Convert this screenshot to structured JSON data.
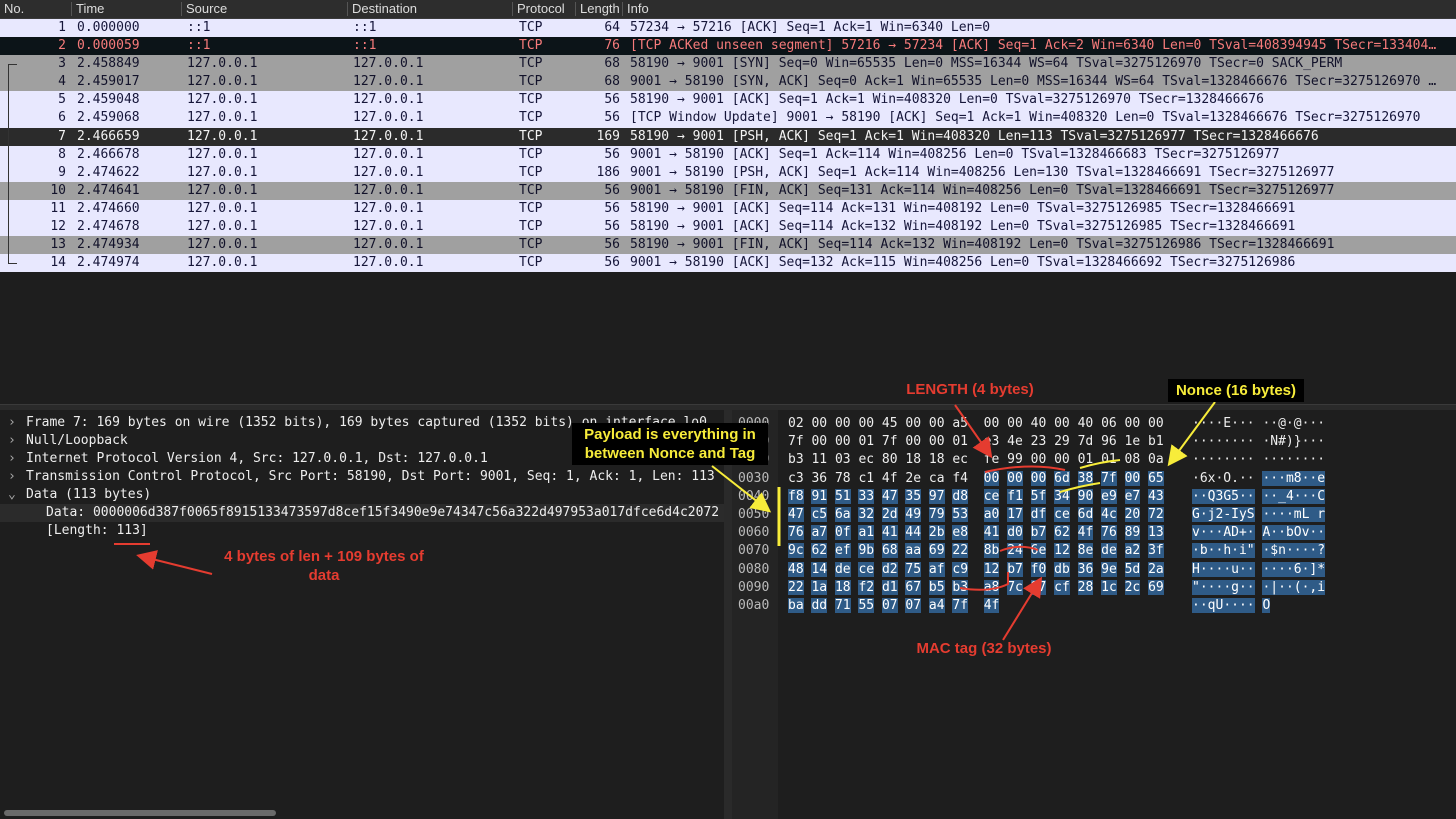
{
  "columns": [
    "No.",
    "Time",
    "Source",
    "Destination",
    "Protocol",
    "Length",
    "Info"
  ],
  "packets": [
    {
      "no": "1",
      "time": "0.000000",
      "src": "::1",
      "dst": "::1",
      "proto": "TCP",
      "len": "64",
      "info": "57234 → 57216 [ACK] Seq=1 Ack=1 Win=6340 Len=0"
    },
    {
      "no": "2",
      "time": "0.000059",
      "src": "::1",
      "dst": "::1",
      "proto": "TCP",
      "len": "76",
      "info": "[TCP ACKed unseen segment] 57216 → 57234 [ACK] Seq=1 Ack=2 Win=6340 Len=0 TSval=408394945 TSecr=133404…"
    },
    {
      "no": "3",
      "time": "2.458849",
      "src": "127.0.0.1",
      "dst": "127.0.0.1",
      "proto": "TCP",
      "len": "68",
      "info": "58190 → 9001 [SYN] Seq=0 Win=65535 Len=0 MSS=16344 WS=64 TSval=3275126970 TSecr=0 SACK_PERM"
    },
    {
      "no": "4",
      "time": "2.459017",
      "src": "127.0.0.1",
      "dst": "127.0.0.1",
      "proto": "TCP",
      "len": "68",
      "info": "9001 → 58190 [SYN, ACK] Seq=0 Ack=1 Win=65535 Len=0 MSS=16344 WS=64 TSval=1328466676 TSecr=3275126970 …"
    },
    {
      "no": "5",
      "time": "2.459048",
      "src": "127.0.0.1",
      "dst": "127.0.0.1",
      "proto": "TCP",
      "len": "56",
      "info": "58190 → 9001 [ACK] Seq=1 Ack=1 Win=408320 Len=0 TSval=3275126970 TSecr=1328466676"
    },
    {
      "no": "6",
      "time": "2.459068",
      "src": "127.0.0.1",
      "dst": "127.0.0.1",
      "proto": "TCP",
      "len": "56",
      "info": "[TCP Window Update] 9001 → 58190 [ACK] Seq=1 Ack=1 Win=408320 Len=0 TSval=1328466676 TSecr=3275126970"
    },
    {
      "no": "7",
      "time": "2.466659",
      "src": "127.0.0.1",
      "dst": "127.0.0.1",
      "proto": "TCP",
      "len": "169",
      "info": "58190 → 9001 [PSH, ACK] Seq=1 Ack=1 Win=408320 Len=113 TSval=3275126977 TSecr=1328466676"
    },
    {
      "no": "8",
      "time": "2.466678",
      "src": "127.0.0.1",
      "dst": "127.0.0.1",
      "proto": "TCP",
      "len": "56",
      "info": "9001 → 58190 [ACK] Seq=1 Ack=114 Win=408256 Len=0 TSval=1328466683 TSecr=3275126977"
    },
    {
      "no": "9",
      "time": "2.474622",
      "src": "127.0.0.1",
      "dst": "127.0.0.1",
      "proto": "TCP",
      "len": "186",
      "info": "9001 → 58190 [PSH, ACK] Seq=1 Ack=114 Win=408256 Len=130 TSval=1328466691 TSecr=3275126977"
    },
    {
      "no": "10",
      "time": "2.474641",
      "src": "127.0.0.1",
      "dst": "127.0.0.1",
      "proto": "TCP",
      "len": "56",
      "info": "9001 → 58190 [FIN, ACK] Seq=131 Ack=114 Win=408256 Len=0 TSval=1328466691 TSecr=3275126977"
    },
    {
      "no": "11",
      "time": "2.474660",
      "src": "127.0.0.1",
      "dst": "127.0.0.1",
      "proto": "TCP",
      "len": "56",
      "info": "58190 → 9001 [ACK] Seq=114 Ack=131 Win=408192 Len=0 TSval=3275126985 TSecr=1328466691"
    },
    {
      "no": "12",
      "time": "2.474678",
      "src": "127.0.0.1",
      "dst": "127.0.0.1",
      "proto": "TCP",
      "len": "56",
      "info": "58190 → 9001 [ACK] Seq=114 Ack=132 Win=408192 Len=0 TSval=3275126985 TSecr=1328466691"
    },
    {
      "no": "13",
      "time": "2.474934",
      "src": "127.0.0.1",
      "dst": "127.0.0.1",
      "proto": "TCP",
      "len": "56",
      "info": "58190 → 9001 [FIN, ACK] Seq=114 Ack=132 Win=408192 Len=0 TSval=3275126986 TSecr=1328466691"
    },
    {
      "no": "14",
      "time": "2.474974",
      "src": "127.0.0.1",
      "dst": "127.0.0.1",
      "proto": "TCP",
      "len": "56",
      "info": "9001 → 58190 [ACK] Seq=132 Ack=115 Win=408256 Len=0 TSval=1328466692 TSecr=3275126986"
    }
  ],
  "details": {
    "frame": "Frame 7: 169 bytes on wire (1352 bits), 169 bytes captured (1352 bits) on interface lo0",
    "null_loopback": "Null/Loopback",
    "ip": "Internet Protocol Version 4, Src: 127.0.0.1, Dst: 127.0.0.1",
    "tcp": "Transmission Control Protocol, Src Port: 58190, Dst Port: 9001, Seq: 1, Ack: 1, Len: 113",
    "data": "Data (113 bytes)",
    "data_value": "Data: 0000006d387f0065f8915133473597d8cef15f3490e9e74347c56a322d497953a017dfce6d4c2072",
    "length": "[Length: 113]"
  },
  "hex_rows": [
    {
      "off": "0000",
      "hex": "02 00 00 00 45 00 00 a5  00 00 40 00 40 06 00 00",
      "ascii": "····E··· ··@·@···"
    },
    {
      "off": "0010",
      "hex": "7f 00 00 01 7f 00 00 01  e3 4e 23 29 7d 96 1e b1",
      "ascii": "········ ·N#)}···"
    },
    {
      "off": "0020",
      "hex": "b3 11 03 ec 80 18 18 ec  fe 99 00 00 01 01 08 0a",
      "ascii": "········ ········"
    },
    {
      "off": "0030",
      "hex": "c3 36 78 c1 4f 2e ca f4  00 00 00 6d 38 7f 00 65",
      "ascii": "·6x·O.·· ···m8··e"
    },
    {
      "off": "0040",
      "hex": "f8 91 51 33 47 35 97 d8  ce f1 5f 34 90 e9 e7 43",
      "ascii": "··Q3G5·· ··_4···C"
    },
    {
      "off": "0050",
      "hex": "47 c5 6a 32 2d 49 79 53  a0 17 df ce 6d 4c 20 72",
      "ascii": "G·j2-IyS ····mL r"
    },
    {
      "off": "0060",
      "hex": "76 a7 0f a1 41 44 2b e8  41 d0 b7 62 4f 76 89 13",
      "ascii": "v···AD+· A··bOv··"
    },
    {
      "off": "0070",
      "hex": "9c 62 ef 9b 68 aa 69 22  8b 24 6e 12 8e de a2 3f",
      "ascii": "·b··h·i\" ·$n····?"
    },
    {
      "off": "0080",
      "hex": "48 14 de ce d2 75 af c9  12 b7 f0 db 36 9e 5d 2a",
      "ascii": "H····u·· ····6·]*"
    },
    {
      "off": "0090",
      "hex": "22 1a 18 f2 d1 67 b5 b3  a8 7c 97 cf 28 1c 2c 69",
      "ascii": "\"····g·· ·|··(·,i"
    },
    {
      "off": "00a0",
      "hex": "ba dd 71 55 07 07 a4 7f  4f",
      "ascii": "··qU···· O"
    }
  ],
  "annotations": {
    "length_label": "LENGTH (4 bytes)",
    "nonce_label": "Nonce (16 bytes)",
    "payload_label": "Payload is everything in between Nonce and Tag",
    "mac_label": "MAC tag (32 bytes)",
    "len_note": "4 bytes of len + 109 bytes of data"
  },
  "colors": {
    "annotation_red": "#e53c30",
    "annotation_yellow": "#f7ec3a",
    "selection": "#2f5b87"
  }
}
